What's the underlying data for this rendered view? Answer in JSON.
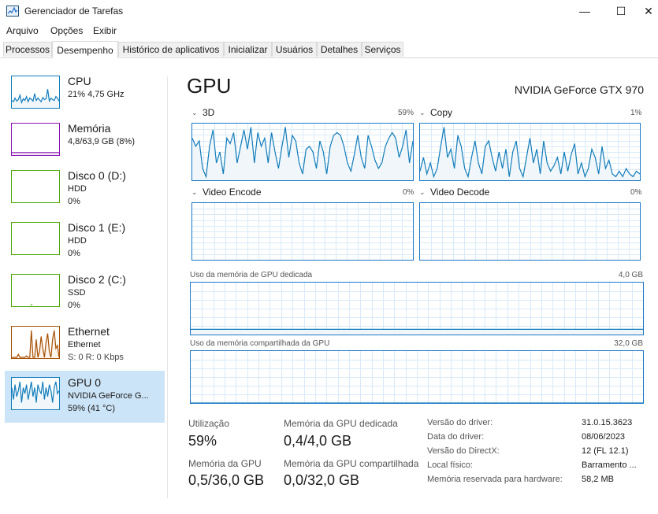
{
  "window": {
    "title": "Gerenciador de Tarefas",
    "minimize_glyph": "—",
    "maximize_glyph": "☐",
    "close_glyph": "✕"
  },
  "menu": [
    "Arquivo",
    "Opções",
    "Exibir"
  ],
  "tabs": [
    "Processos",
    "Desempenho",
    "Histórico de aplicativos",
    "Inicializar",
    "Usuários",
    "Detalhes",
    "Serviços"
  ],
  "active_tab": "Desempenho",
  "sidebar": [
    {
      "name": "CPU",
      "line1": "21%  4,75 GHz",
      "line2": "",
      "color": "#117dbb",
      "level": 0.21
    },
    {
      "name": "Memória",
      "line1": "4,8/63,9 GB (8%)",
      "line2": "",
      "color": "#8b12ae",
      "level": 0.08
    },
    {
      "name": "Disco 0 (D:)",
      "line1": "HDD",
      "line2": "0%",
      "color": "#4da60c",
      "level": 0
    },
    {
      "name": "Disco 1 (E:)",
      "line1": "HDD",
      "line2": "0%",
      "color": "#4da60c",
      "level": 0
    },
    {
      "name": "Disco 2 (C:)",
      "line1": "SSD",
      "line2": "0%",
      "color": "#4da60c",
      "level": 0
    },
    {
      "name": "Ethernet",
      "line1": "Ethernet",
      "line2": "S: 0 R: 0 Kbps",
      "color": "#a74f01",
      "level": 0
    },
    {
      "name": "GPU 0",
      "line1": "NVIDIA GeForce G...",
      "line2": "59%  (41 °C)",
      "color": "#117dbb",
      "level": 0.59
    }
  ],
  "gpu": {
    "title": "GPU",
    "model": "NVIDIA GeForce GTX 970",
    "engines": [
      {
        "name": "3D",
        "pct": "59%"
      },
      {
        "name": "Copy",
        "pct": "1%"
      },
      {
        "name": "Video Encode",
        "pct": "0%"
      },
      {
        "name": "Video Decode",
        "pct": "0%"
      }
    ],
    "dedicated_mem_label": "Uso da memória de GPU dedicada",
    "dedicated_mem_max": "4,0 GB",
    "shared_mem_label": "Uso da memória compartilhada da GPU",
    "shared_mem_max": "32,0 GB",
    "dedicated_mem_level": 0.1,
    "shared_mem_level": 0
  },
  "stats": [
    {
      "label": "Utilização",
      "value": "59%"
    },
    {
      "label": "Memória da GPU dedicada",
      "value": "0,4/4,0 GB"
    },
    {
      "label": "Memória da GPU",
      "value": "0,5/36,0 GB"
    },
    {
      "label": "Memória da GPU compartilhada",
      "value": "0,0/32,0 GB"
    }
  ],
  "info": [
    {
      "key": "Versão do driver:",
      "value": "31.0.15.3623"
    },
    {
      "key": "Data do driver:",
      "value": "08/06/2023"
    },
    {
      "key": "Versão do DirectX:",
      "value": "12 (FL 12.1)"
    },
    {
      "key": "Local físico:",
      "value": "Barramento ..."
    },
    {
      "key": "Memória reservada para hardware:",
      "value": "58,2 MB"
    }
  ],
  "series": {
    "cpu": [
      0.22,
      0.18,
      0.3,
      0.2,
      0.25,
      0.4,
      0.15,
      0.28,
      0.22,
      0.35,
      0.18,
      0.3,
      0.26,
      0.2,
      0.45,
      0.22,
      0.3,
      0.24,
      0.18,
      0.32,
      0.25,
      0.28,
      0.6,
      0.2,
      0.3,
      0.25,
      0.22,
      0.35,
      0.3,
      0.2
    ],
    "ethernet": [
      0,
      0,
      0,
      0,
      0.1,
      0,
      0,
      0,
      0,
      0.05,
      0,
      0,
      0.9,
      0,
      0,
      0.6,
      0,
      0.2,
      0.7,
      0.3,
      0,
      0.5,
      0.8,
      0.2,
      0,
      0.6,
      0.9,
      0.3,
      0.4,
      0
    ],
    "gpu_thumb": [
      0.7,
      0.3,
      0.8,
      0.4,
      0.6,
      0.9,
      0.2,
      0.7,
      0.5,
      0.8,
      0.3,
      0.6,
      0.9,
      0.4,
      0.7,
      0.2,
      0.8,
      0.6,
      0.5,
      0.9,
      0.3,
      0.7,
      0.4,
      0.8,
      0.6,
      0.2,
      0.7,
      0.9,
      0.5,
      0.6
    ],
    "3d": [
      0.75,
      0.6,
      0.7,
      0.2,
      0.05,
      0.6,
      0.9,
      0.3,
      0.5,
      0.1,
      0.75,
      0.65,
      0.85,
      0.3,
      0.6,
      0.9,
      0.55,
      0.95,
      0.3,
      0.85,
      0.6,
      0.75,
      0.3,
      0.85,
      0.5,
      0.2,
      0.6,
      0.95,
      0.4,
      0.8,
      0.7,
      0.3,
      0.1,
      0.55,
      0.6,
      0.5,
      0.2,
      0.7,
      0.5,
      0.1,
      0.6,
      0.8,
      0.85,
      0.8,
      0.6,
      0.3,
      0.15,
      0.45,
      0.8,
      0.4,
      0.2,
      0.8,
      0.6,
      0.35,
      0.2,
      0.3,
      0.6,
      0.75,
      0.85,
      0.75,
      0.4,
      0.6,
      0.9,
      0.3,
      0.7
    ],
    "copy": [
      0.15,
      0.4,
      0.1,
      0.3,
      0.05,
      0.2,
      0.6,
      0.95,
      0.4,
      0.55,
      0.2,
      0.8,
      0.6,
      0.2,
      0.05,
      0.4,
      0.7,
      0.3,
      0.1,
      0.6,
      0.7,
      0.4,
      0.15,
      0.5,
      0.2,
      0.55,
      0.05,
      0.5,
      0.7,
      0.2,
      0.05,
      0.4,
      0.75,
      0.3,
      0.55,
      0.1,
      0.7,
      0.3,
      0.15,
      0.25,
      0.4,
      0.1,
      0.5,
      0.15,
      0.45,
      0.65,
      0.1,
      0.3,
      0.05,
      0.2,
      0.55,
      0.4,
      0.1,
      0.6,
      0.2,
      0.35,
      0.1,
      0.05,
      0.15,
      0.05,
      0.2,
      0.1,
      0.05,
      0.15,
      0.1
    ]
  }
}
